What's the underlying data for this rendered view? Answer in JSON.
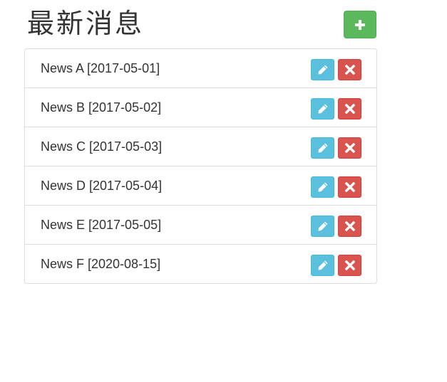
{
  "header": {
    "title": "最新消息",
    "add_icon": "plus-icon",
    "add_color": "#5cb85c"
  },
  "actions": {
    "edit_icon": "pencil-icon",
    "edit_color": "#5bc0de",
    "delete_icon": "remove-icon",
    "delete_color": "#d9534f"
  },
  "news": [
    {
      "text": "News A [2017-05-01]"
    },
    {
      "text": "News B [2017-05-02]"
    },
    {
      "text": "News C [2017-05-03]"
    },
    {
      "text": "News D [2017-05-04]"
    },
    {
      "text": "News E [2017-05-05]"
    },
    {
      "text": "News F [2020-08-15]"
    }
  ]
}
